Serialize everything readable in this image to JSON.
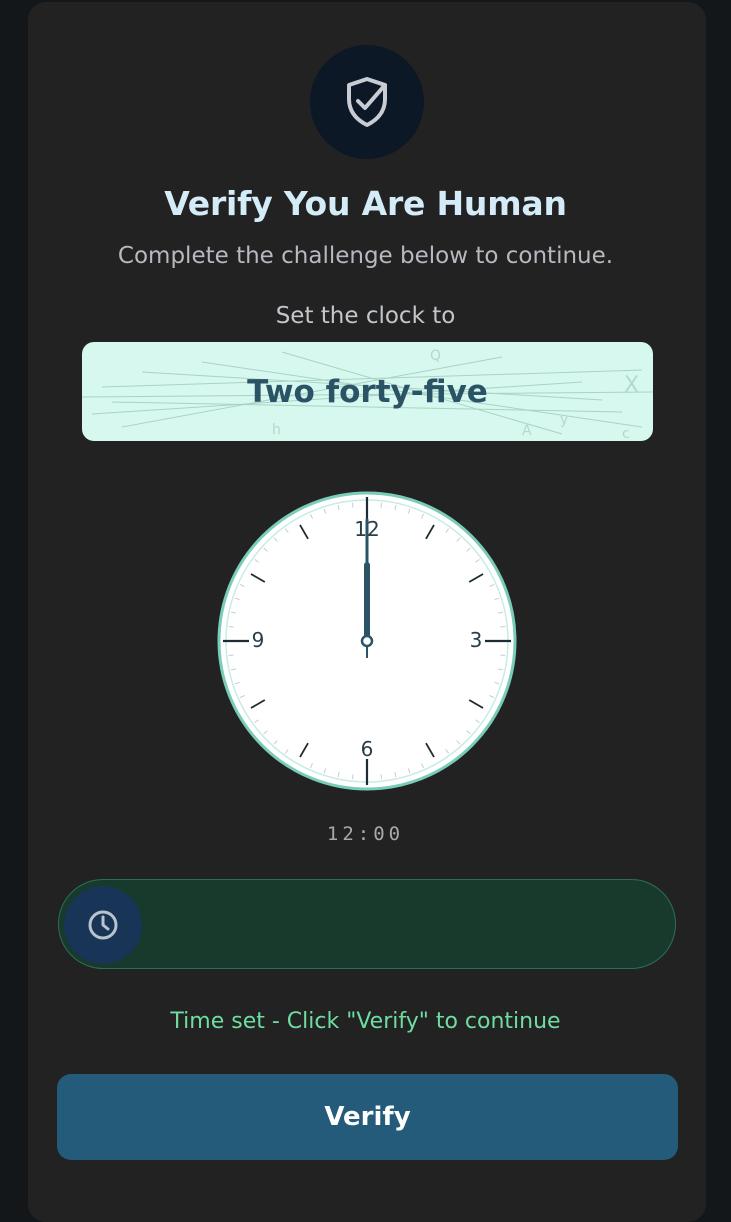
{
  "header": {
    "icon": "shield-check-icon",
    "title": "Verify You Are Human",
    "subtitle": "Complete the challenge below to continue."
  },
  "challenge": {
    "prompt_label": "Set the clock to",
    "target_time_text": "Two forty-five"
  },
  "clock": {
    "numerals": {
      "twelve": "12",
      "three": "3",
      "six": "6",
      "nine": "9"
    },
    "hour": 12,
    "minute": 0,
    "digital_display": "12:00"
  },
  "slider": {
    "handle_icon": "clock-icon"
  },
  "status": {
    "message": "Time set - Click \"Verify\" to continue"
  },
  "actions": {
    "verify_label": "Verify"
  },
  "colors": {
    "page_background": "#14171a",
    "card_background": "#222222",
    "title": "#d4ecf8",
    "captcha_background": "#d6f8ee",
    "captcha_text": "#2a5366",
    "clock_hands": "#2a5366",
    "slider_track": "#183a2c",
    "slider_handle": "#183457",
    "status_text": "#6fdca0",
    "verify_button": "#245a7a"
  }
}
